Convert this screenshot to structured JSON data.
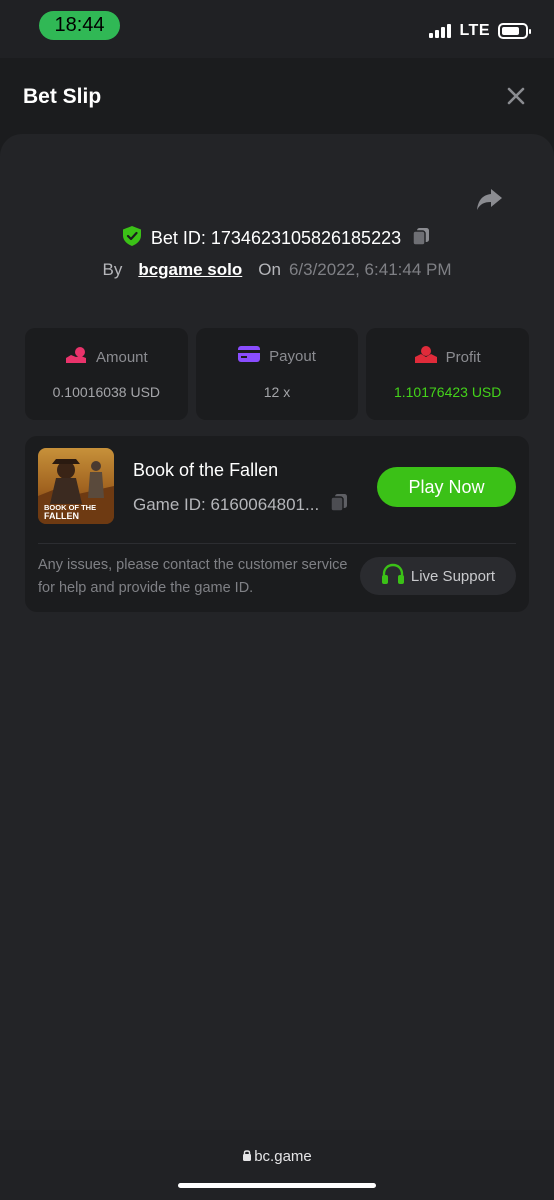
{
  "status_bar": {
    "time": "18:44",
    "network": "LTE"
  },
  "header": {
    "title": "Bet Slip",
    "close_icon": "close-icon",
    "share_icon": "share-icon"
  },
  "bet": {
    "id_text": "Bet ID: 1734623105826185223",
    "by_label": "By",
    "author": "bcgame solo",
    "on_label": "On",
    "date": "6/3/2022, 6:41:44 PM"
  },
  "stats": [
    {
      "label": "Amount",
      "value": "0.10016038 USD",
      "icon": "coin-hand-icon"
    },
    {
      "label": "Payout",
      "value": "12 x",
      "icon": "card-icon"
    },
    {
      "label": "Profit",
      "value": "1.10176423 USD",
      "icon": "profit-icon"
    }
  ],
  "game": {
    "name": "Book of the Fallen",
    "id_text": "Game ID: 6160064801...",
    "thumb_line1": "BOOK OF THE",
    "thumb_line2": "FALLEN",
    "play_label": "Play Now",
    "help_text": "Any issues, please contact the customer service for help and provide the game ID.",
    "support_label": "Live Support"
  },
  "browser": {
    "url": "bc.game"
  },
  "colors": {
    "accent": "#3bc117",
    "profit": "#44d31a",
    "amount_icon": "#e9336b",
    "payout_icon": "#8a4dff",
    "profit_icon": "#e02b3a"
  }
}
